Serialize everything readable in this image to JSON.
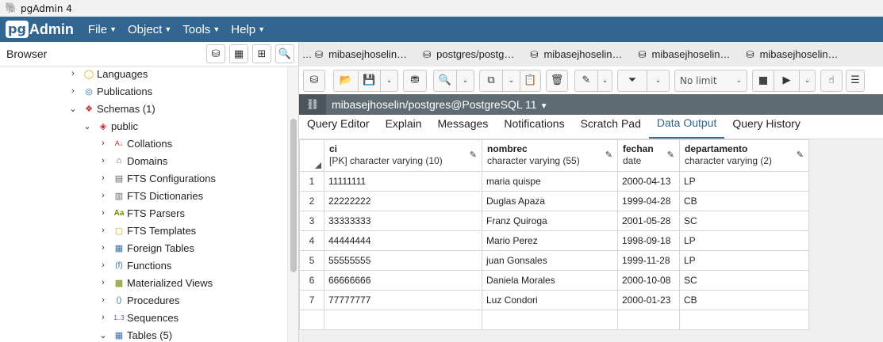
{
  "window": {
    "title": "pgAdmin 4"
  },
  "menubar": {
    "logo_pg": "pg",
    "logo_admin": "Admin",
    "items": [
      "File",
      "Object",
      "Tools",
      "Help"
    ]
  },
  "browser": {
    "title": "Browser",
    "tree": [
      {
        "label": "Languages",
        "icon": "languages-icon",
        "depth": 0,
        "expanded": false
      },
      {
        "label": "Publications",
        "icon": "publications-icon",
        "depth": 0,
        "expanded": false
      },
      {
        "label": "Schemas (1)",
        "icon": "schemas-icon",
        "depth": 0,
        "expanded": true
      },
      {
        "label": "public",
        "icon": "schema-icon",
        "depth": 1,
        "expanded": true
      },
      {
        "label": "Collations",
        "icon": "collations-icon",
        "depth": 2,
        "expanded": false
      },
      {
        "label": "Domains",
        "icon": "domains-icon",
        "depth": 2,
        "expanded": false
      },
      {
        "label": "FTS Configurations",
        "icon": "fts-configurations-icon",
        "depth": 2,
        "expanded": false
      },
      {
        "label": "FTS Dictionaries",
        "icon": "fts-dictionaries-icon",
        "depth": 2,
        "expanded": false
      },
      {
        "label": "FTS Parsers",
        "icon": "fts-parsers-icon",
        "depth": 2,
        "expanded": false
      },
      {
        "label": "FTS Templates",
        "icon": "fts-templates-icon",
        "depth": 2,
        "expanded": false
      },
      {
        "label": "Foreign Tables",
        "icon": "foreign-tables-icon",
        "depth": 2,
        "expanded": false
      },
      {
        "label": "Functions",
        "icon": "functions-icon",
        "depth": 2,
        "expanded": false
      },
      {
        "label": "Materialized Views",
        "icon": "materialized-views-icon",
        "depth": 2,
        "expanded": false
      },
      {
        "label": "Procedures",
        "icon": "procedures-icon",
        "depth": 2,
        "expanded": false
      },
      {
        "label": "Sequences",
        "icon": "sequences-icon",
        "depth": 2,
        "expanded": false
      },
      {
        "label": "Tables (5)",
        "icon": "tables-icon",
        "depth": 2,
        "expanded": true
      }
    ]
  },
  "query_tabs": [
    "mibasejhoselin…",
    "postgres/postg…",
    "mibasejhoselin…",
    "mibasejhoselin…",
    "mibasejhoselin…"
  ],
  "toolbar": {
    "limit": "No limit"
  },
  "connection": {
    "label": "mibasejhoselin/postgres@PostgreSQL 11"
  },
  "subtabs": [
    "Query Editor",
    "Explain",
    "Messages",
    "Notifications",
    "Scratch Pad",
    "Data Output",
    "Query History"
  ],
  "subtab_active": "Data Output",
  "grid": {
    "columns": [
      {
        "name": "ci",
        "type": "[PK] character varying (10)"
      },
      {
        "name": "nombrec",
        "type": "character varying (55)"
      },
      {
        "name": "fechan",
        "type": "date"
      },
      {
        "name": "departamento",
        "type": "character varying (2)"
      }
    ],
    "rows": [
      {
        "n": "1",
        "ci": "11111111",
        "nombrec": " maria quispe",
        "fechan": "2000-04-13",
        "departamento": "LP"
      },
      {
        "n": "2",
        "ci": "22222222",
        "nombrec": "Duglas Apaza",
        "fechan": "1999-04-28",
        "departamento": "CB"
      },
      {
        "n": "3",
        "ci": "33333333",
        "nombrec": "Franz Quiroga",
        "fechan": "2001-05-28",
        "departamento": "SC"
      },
      {
        "n": "4",
        "ci": "44444444",
        "nombrec": "Mario Perez",
        "fechan": "1998-09-18",
        "departamento": "LP"
      },
      {
        "n": "5",
        "ci": "55555555",
        "nombrec": "juan Gonsales",
        "fechan": "1999-11-28",
        "departamento": "LP"
      },
      {
        "n": "6",
        "ci": "66666666",
        "nombrec": "Daniela Morales",
        "fechan": "2000-10-08",
        "departamento": "SC"
      },
      {
        "n": "7",
        "ci": "77777777",
        "nombrec": "Luz Condori",
        "fechan": "2000-01-23",
        "departamento": "CB"
      }
    ]
  },
  "colors": {
    "brand": "#326690",
    "connbar": "#5f6b73"
  }
}
